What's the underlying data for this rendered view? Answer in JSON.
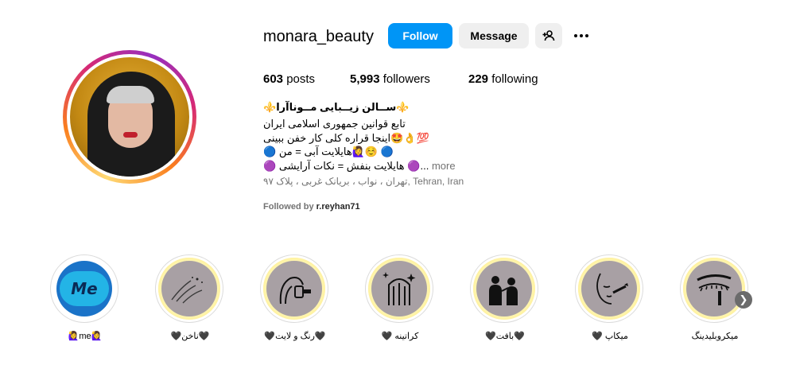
{
  "profile": {
    "username": "monara_beauty",
    "follow_label": "Follow",
    "message_label": "Message",
    "posts_count": "603",
    "posts_label": "posts",
    "followers_count": "5,993",
    "followers_label": "followers",
    "following_count": "229",
    "following_label": "following"
  },
  "bio": {
    "lines": [
      "⚜️ســالن زیــبایی مــوناآرا⚜️",
      "تابع قوانین جمهوری اسلامی ایران",
      "اینجا قراره کلی کار خفن ببینی🤩👌💯",
      "🔵 هایلایت آبی = من🙋‍♀️☺️ 🔵",
      "🟣 هایلایت بنفش = نکات آرایشی 🟣..."
    ],
    "more_label": "more",
    "address": "تهران ، نواب ، بریانک غربی ، پلاک ۹۷, Tehran, Iran",
    "followed_by_prefix": "Followed by",
    "followed_by_user": "r.reyhan71"
  },
  "highlights": [
    {
      "label": "🙋‍♀️me🙋‍♀️",
      "icon": "me-logo-icon",
      "text": "Me"
    },
    {
      "label": "🖤ناخن🖤",
      "icon": "nail-icon"
    },
    {
      "label": "🖤رنگ و لایت🖤",
      "icon": "hair-dye-icon"
    },
    {
      "label": "🖤 کراتینه",
      "icon": "keratin-icon"
    },
    {
      "label": "🖤بافت🖤",
      "icon": "braiding-icon"
    },
    {
      "label": "🖤 میکاپ",
      "icon": "makeup-icon"
    },
    {
      "label": "میکروبلیدینگ",
      "icon": "microblading-icon"
    }
  ],
  "colors": {
    "follow_button": "#0095f6",
    "secondary_button": "#efefef",
    "highlight_glow": "#fff7b8",
    "highlight_fill": "#a8a0a4"
  }
}
